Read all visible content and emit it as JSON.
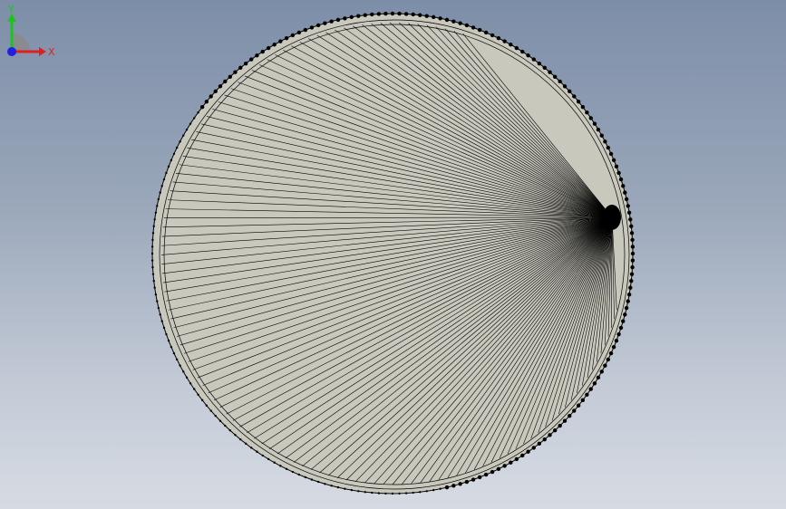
{
  "viewport": {
    "background_top": "#7d8ea8",
    "background_bottom": "#d6dbe3"
  },
  "model": {
    "shape": "disc",
    "fill_color": "#c9c8bd",
    "edge_color": "#000000",
    "fan_line_count": 120
  },
  "triad": {
    "x_label": "X",
    "y_label": "Y",
    "x_color": "#e02020",
    "y_color": "#20c020",
    "z_color": "#2020e0"
  }
}
